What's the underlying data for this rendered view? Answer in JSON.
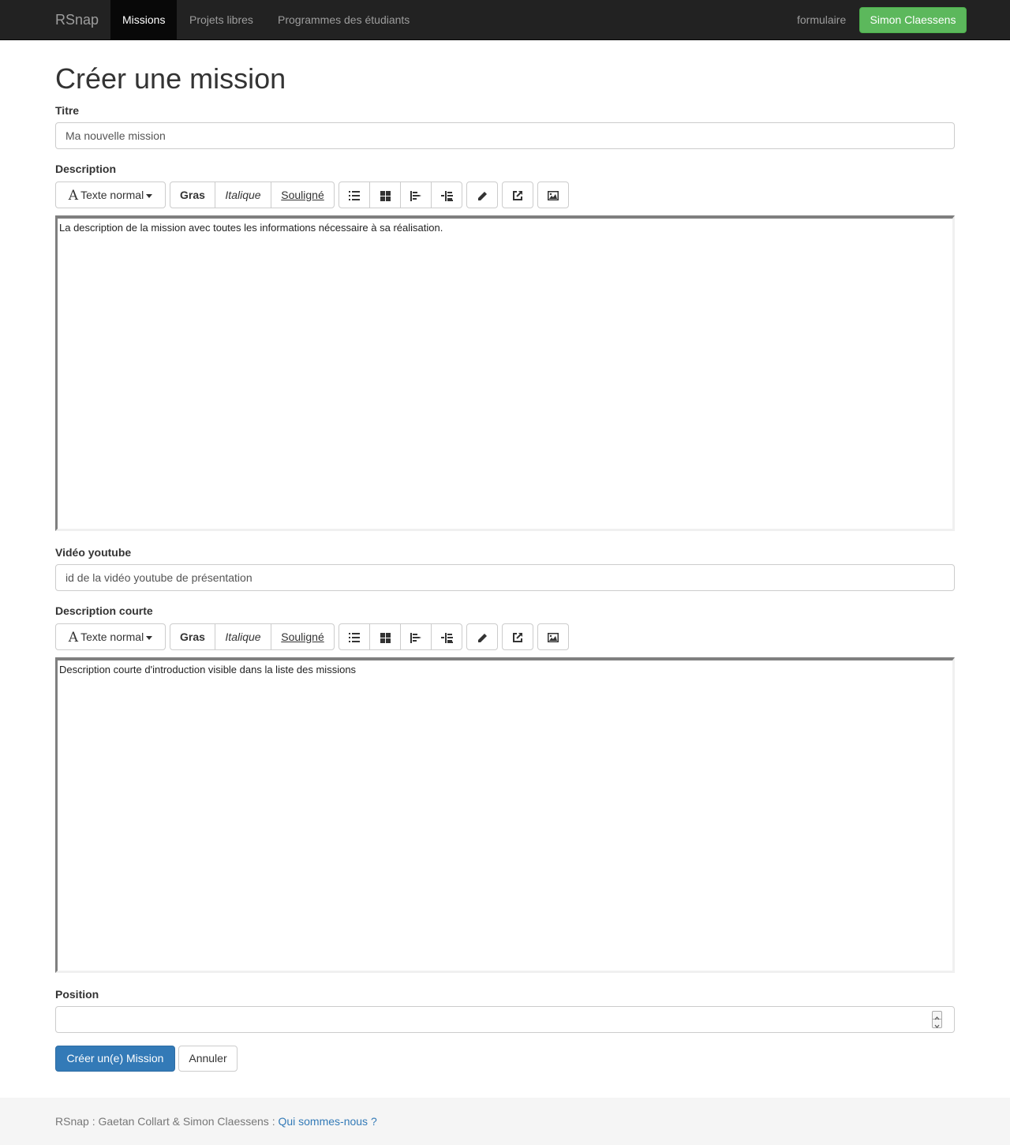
{
  "navbar": {
    "brand": "RSnap",
    "items": [
      {
        "label": "Missions",
        "active": true
      },
      {
        "label": "Projets libres",
        "active": false
      },
      {
        "label": "Programmes des étudiants",
        "active": false
      }
    ],
    "right_link": "formulaire",
    "user_button": "Simon Claessens"
  },
  "page": {
    "title": "Créer une mission"
  },
  "form": {
    "titre": {
      "label": "Titre",
      "value": "Ma nouvelle mission"
    },
    "description": {
      "label": "Description",
      "content": "La description de la mission avec toutes les informations nécessaire à sa réalisation."
    },
    "video": {
      "label": "Vidéo youtube",
      "placeholder": "id de la vidéo youtube de présentation"
    },
    "description_courte": {
      "label": "Description courte",
      "content": "Description courte d'introduction visible dans la liste des missions"
    },
    "position": {
      "label": "Position",
      "value": ""
    }
  },
  "toolbar": {
    "font_style": "Texte normal",
    "bold": "Gras",
    "italic": "Italique",
    "underline": "Souligné"
  },
  "actions": {
    "submit": "Créer un(e) Mission",
    "cancel": "Annuler"
  },
  "footer": {
    "text": "RSnap : Gaetan Collart & Simon Claessens : ",
    "link": "Qui sommes-nous ?"
  },
  "colors": {
    "primary": "#337ab7",
    "success": "#5cb85c",
    "navbar": "#222222"
  }
}
